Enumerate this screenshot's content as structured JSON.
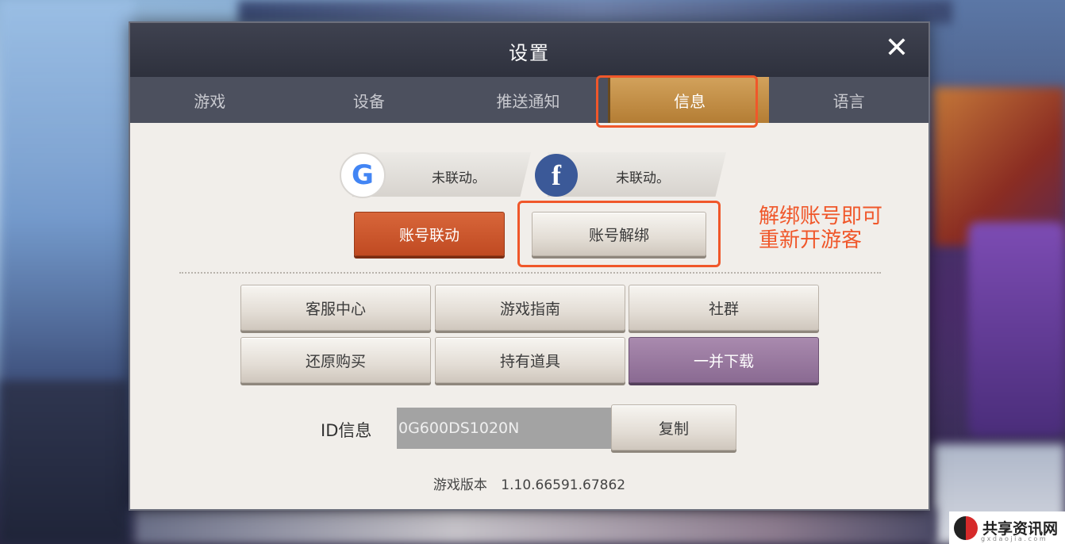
{
  "dialog": {
    "title": "设置",
    "close_symbol": "✕",
    "tabs": [
      {
        "label": "游戏"
      },
      {
        "label": "设备"
      },
      {
        "label": "推送通知"
      },
      {
        "label": "信息",
        "active": true
      },
      {
        "label": "语言"
      }
    ]
  },
  "accounts": {
    "google": {
      "icon": "google-icon",
      "status": "未联动。"
    },
    "facebook": {
      "icon": "facebook-icon",
      "status": "未联动。"
    },
    "link_button": "账号联动",
    "unlink_button": "账号解绑"
  },
  "menu": {
    "customer_service": "客服中心",
    "game_guide": "游戏指南",
    "community": "社群",
    "restore_purchase": "还原购买",
    "owned_items": "持有道具",
    "download_all": "一并下载"
  },
  "id_info": {
    "label": "ID信息",
    "value": "0G600DS1020N",
    "copy_button": "复制"
  },
  "version": {
    "label": "游戏版本",
    "value": "1.10.66591.67862"
  },
  "annotation": {
    "text": "解绑账号即可\n重新开游客",
    "color": "#f0572a"
  },
  "watermark": {
    "text": "共享资讯网",
    "subtext": "g x d a o j i a . c o m"
  },
  "colors": {
    "accent_tab": "#c08a40",
    "orange_button": "#c9532a",
    "purple_button": "#967599"
  }
}
